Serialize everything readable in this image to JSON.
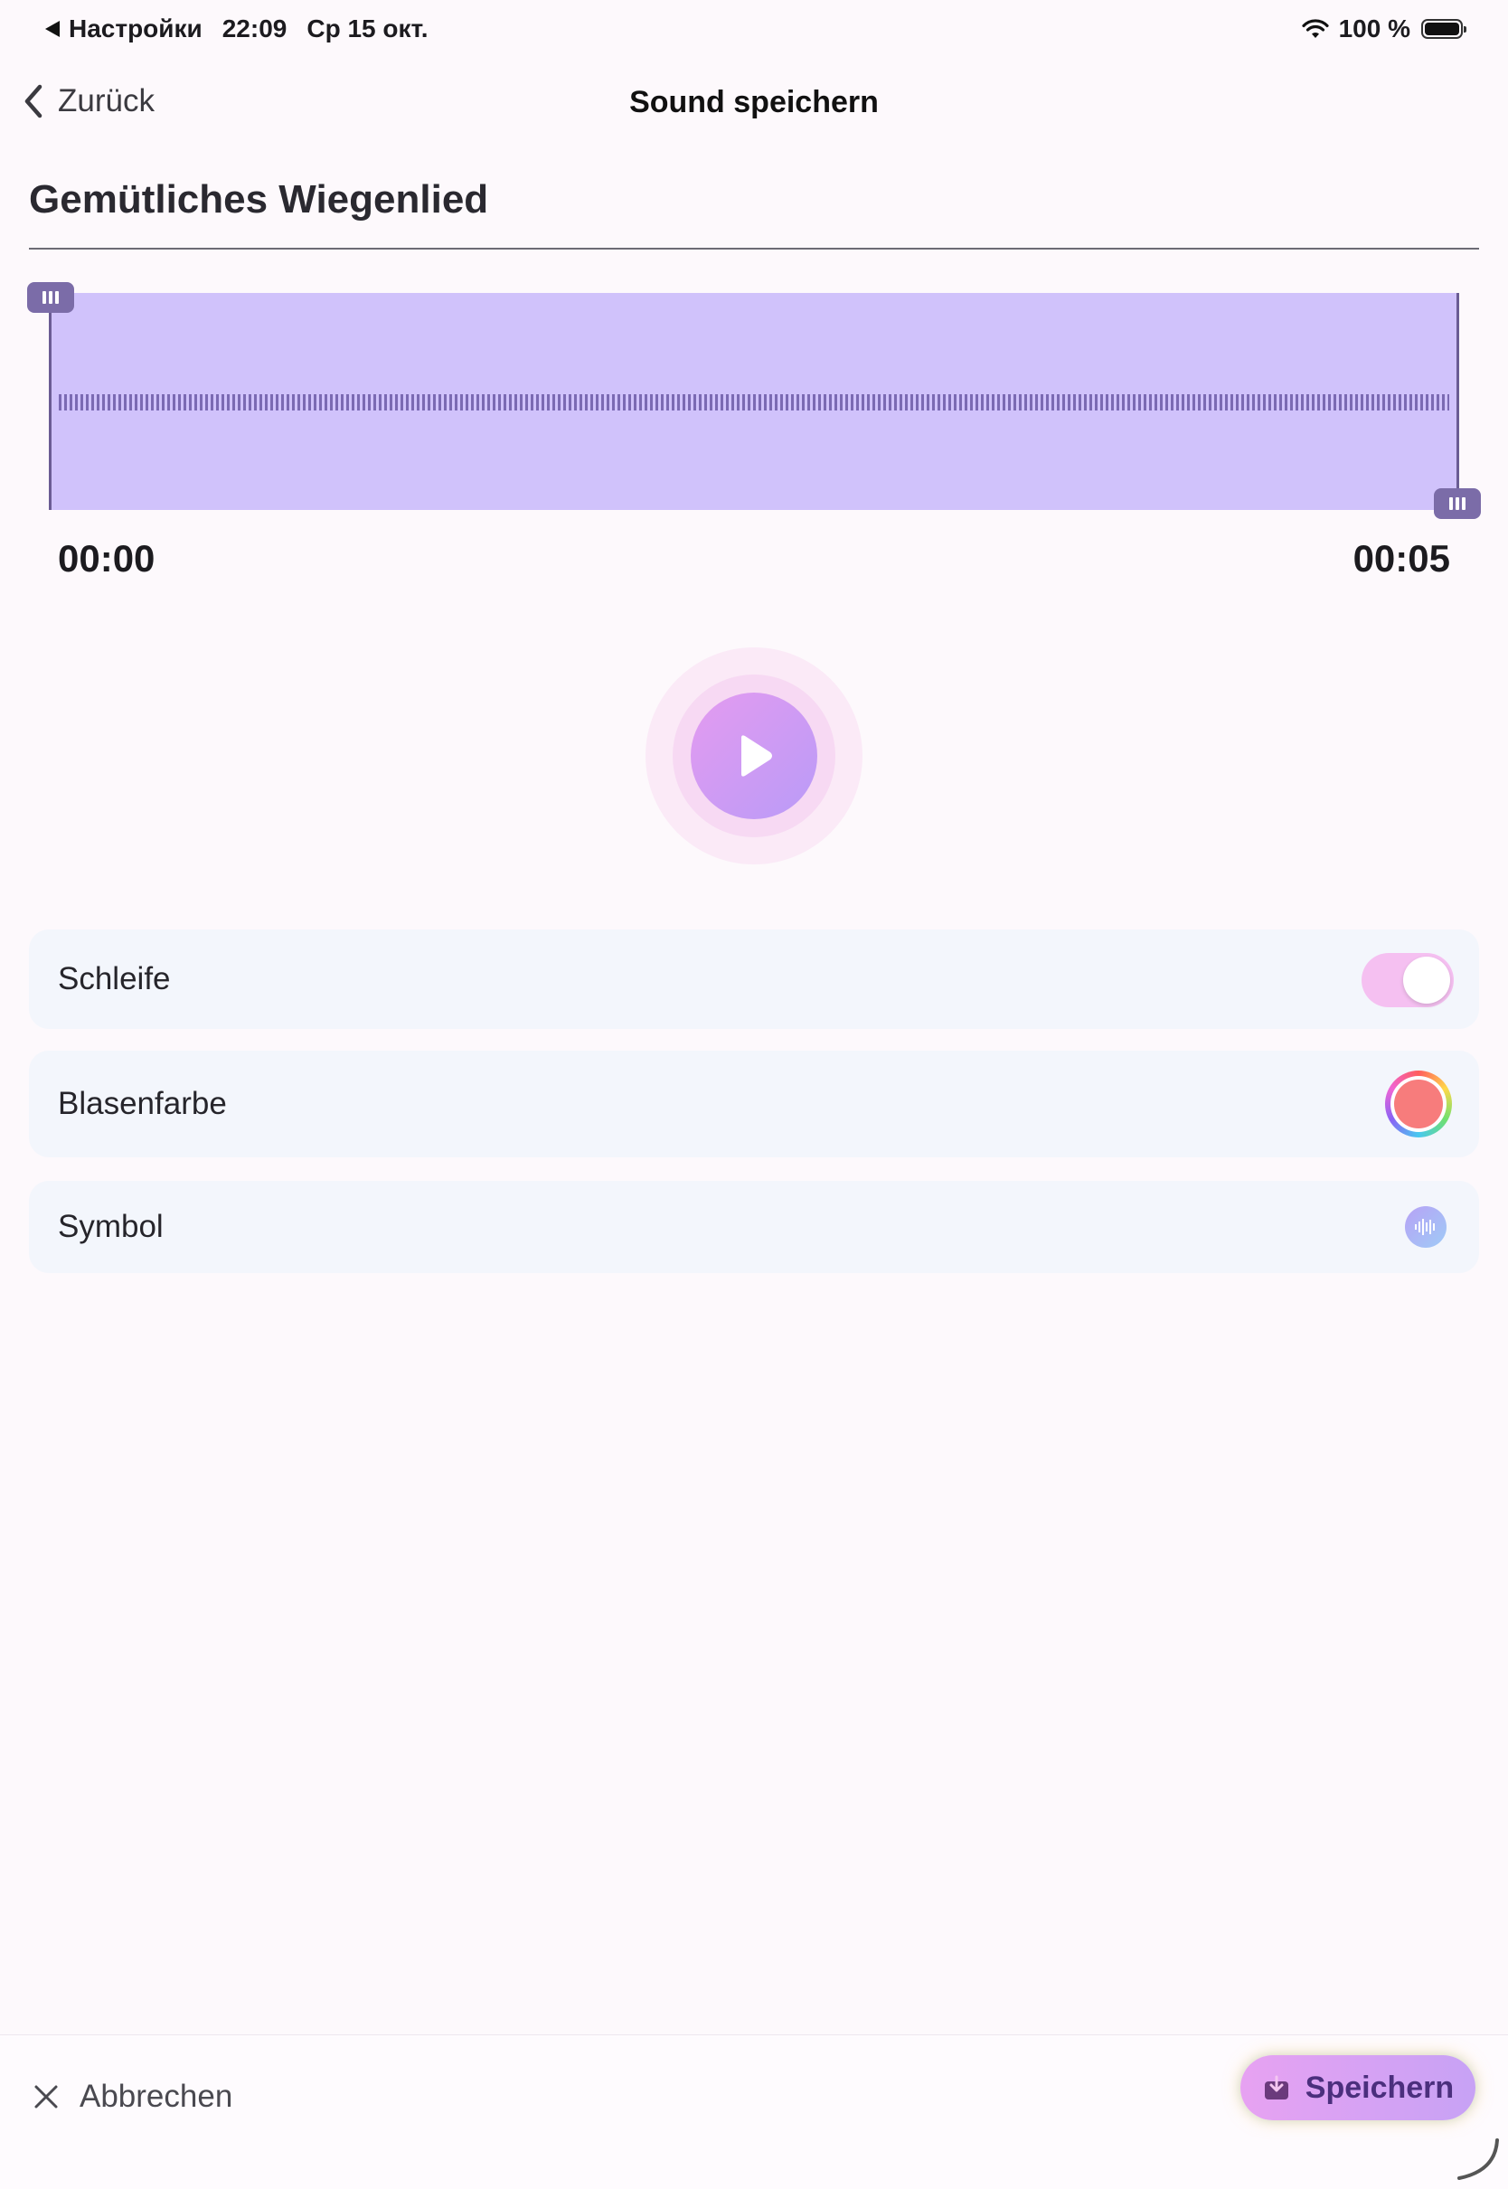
{
  "status_bar": {
    "back_app": "Настройки",
    "time": "22:09",
    "date": "Ср 15 окт.",
    "battery": "100 %"
  },
  "nav": {
    "back_label": "Zurück",
    "title": "Sound speichern"
  },
  "sound": {
    "name": "Gemütliches Wiegenlied",
    "start_time": "00:00",
    "end_time": "00:05"
  },
  "settings": {
    "loop_label": "Schleife",
    "loop_enabled": true,
    "color_label": "Blasenfarbe",
    "color_value": "#f77c7c",
    "symbol_label": "Symbol",
    "symbol_icon": "waveform-icon"
  },
  "actions": {
    "cancel_label": "Abbrechen",
    "save_label": "Speichern"
  },
  "colors": {
    "accent": "#c7a2f5",
    "waveform_bg": "#d0c2fb",
    "toggle_on": "#f5c0f1"
  }
}
